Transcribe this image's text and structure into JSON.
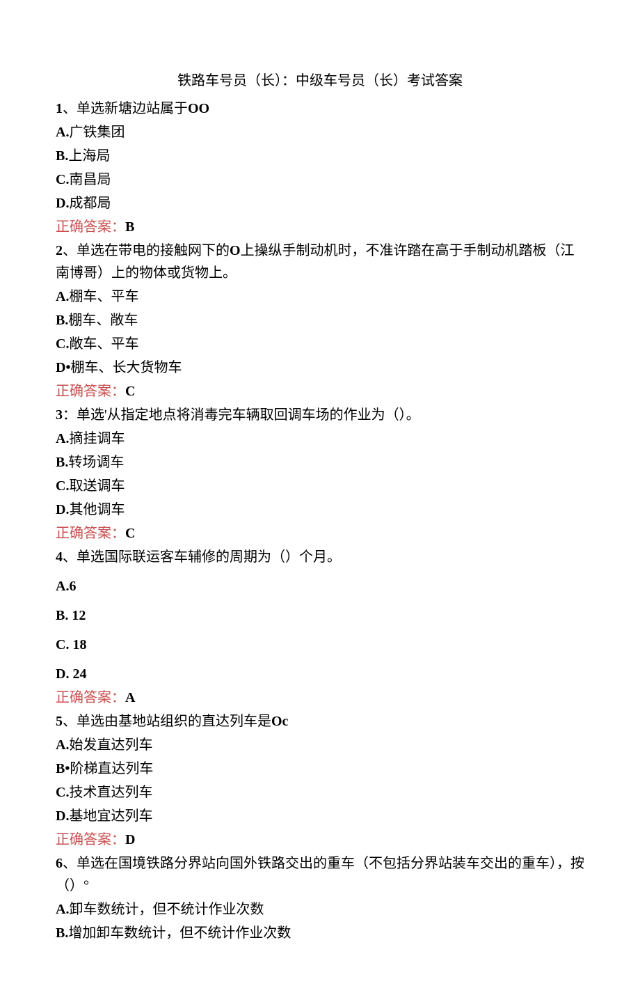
{
  "title": "铁路车号员（长）：中级车号员（长）考试答案",
  "q1": {
    "text_prefix": "1",
    "text": "、单选新塘边站属于",
    "text_suffix": "OO",
    "A": "广铁集团",
    "B": "上海局",
    "C": "南昌局",
    "D": "成都局",
    "answer": "B"
  },
  "q2": {
    "text_prefix": "2",
    "text1": "、单选在带电的接触网下的",
    "text_mid": "O",
    "text2": "上操纵手制动机时，不准许踏在高于手制动机踏板（江南博哥）上的物体或货物上。",
    "A": "棚车、平车",
    "B": "棚车、敞车",
    "C": "敞车、平车",
    "D_prefix": "D•",
    "D": "棚车、长大货物车",
    "answer": "C"
  },
  "q3": {
    "text_prefix": "3",
    "text": "：单选'从指定地点将消毒完车辆取回调车场的作业为（）。",
    "A": "摘挂调车",
    "B": "转场调车",
    "C": "取送调车",
    "D": "其他调车",
    "answer": "C"
  },
  "q4": {
    "text_prefix": "4",
    "text": "、单选国际联运客车辅修的周期为（）个月。",
    "A": "A.6",
    "B": "B.  12",
    "C": "C.  18",
    "D": "D.  24",
    "answer": "A"
  },
  "q5": {
    "text_prefix": "5",
    "text": "、单选由基地站组织的直达列车是",
    "text_suffix": "Oc",
    "A": "始发直达列车",
    "B_prefix": "B•",
    "B": "阶梯直达列车",
    "C": "技术直达列车",
    "D": "基地宜达列车",
    "answer": "D"
  },
  "q6": {
    "text_prefix": "6",
    "text": "、单选在国境铁路分界站向国外铁路交出的重车（不包括分界站装车交出的重车），按（）°",
    "A": "卸车数统计，但不统计作业次数",
    "B": "增加卸车数统计，但不统计作业次数"
  },
  "answer_label": "正确答案："
}
